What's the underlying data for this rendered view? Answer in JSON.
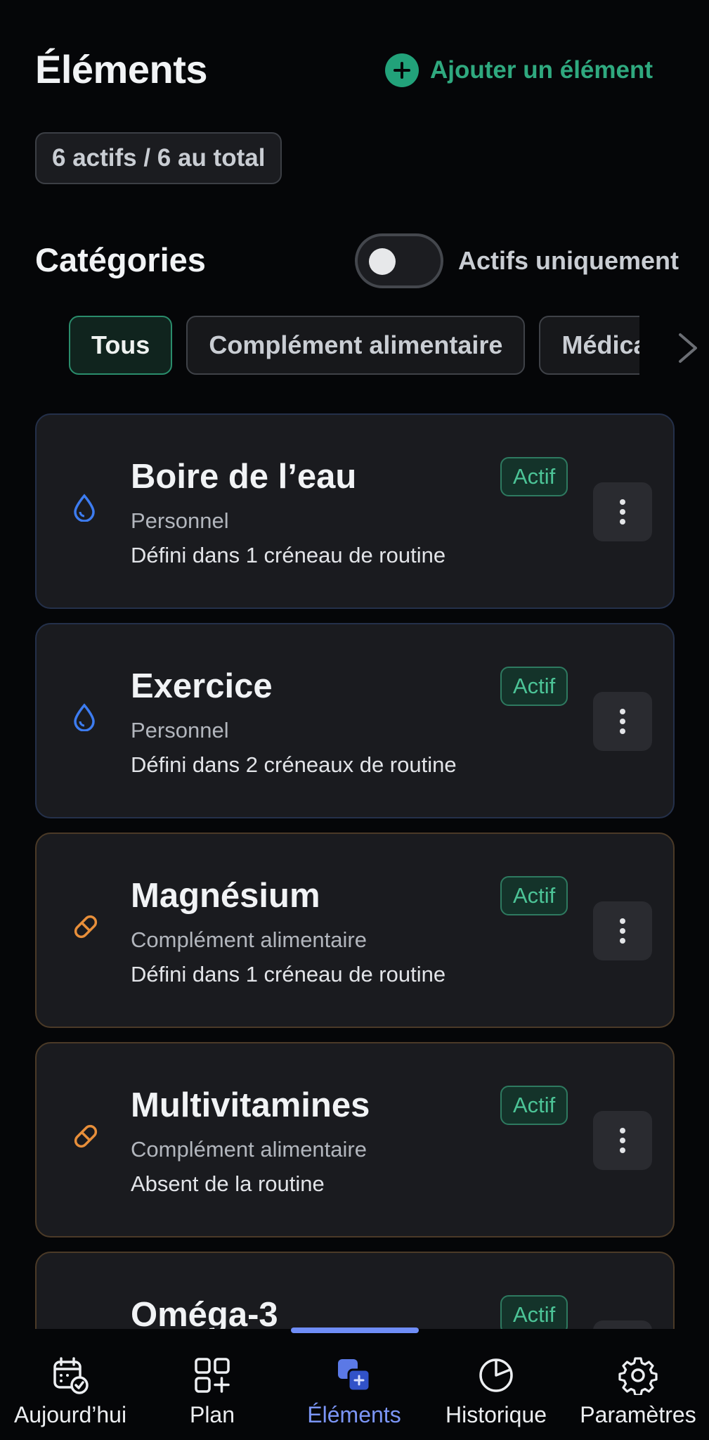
{
  "header": {
    "title": "Éléments",
    "add_label": "Ajouter un élément"
  },
  "summary": {
    "count_label": "6 actifs / 6 au total"
  },
  "categories": {
    "title": "Catégories",
    "toggle_label": "Actifs uniquement",
    "toggle_on": false,
    "chips": [
      {
        "label": "Tous",
        "active": true
      },
      {
        "label": "Complément alimentaire",
        "active": false
      },
      {
        "label": "Médica",
        "active": false
      }
    ]
  },
  "items": [
    {
      "title": "Boire de l’eau",
      "category": "Personnel",
      "routine": "Défini dans 1 créneau de routine",
      "status": "Actif",
      "icon": "water-drop-icon"
    },
    {
      "title": "Exercice",
      "category": "Personnel",
      "routine": "Défini dans 2 créneaux de routine",
      "status": "Actif",
      "icon": "water-drop-icon"
    },
    {
      "title": "Magnésium",
      "category": "Complément alimentaire",
      "routine": "Défini dans 1 créneau de routine",
      "status": "Actif",
      "icon": "pill-icon"
    },
    {
      "title": "Multivitamines",
      "category": "Complément alimentaire",
      "routine": "Absent de la routine",
      "status": "Actif",
      "icon": "pill-icon"
    },
    {
      "title": "Oméga-3",
      "category": "",
      "routine": "",
      "status": "Actif",
      "icon": "pill-icon"
    }
  ],
  "bottom_nav": [
    {
      "label": "Aujourd’hui",
      "icon": "calendar-check-icon",
      "active": false
    },
    {
      "label": "Plan",
      "icon": "grid-plus-icon",
      "active": false
    },
    {
      "label": "Éléments",
      "icon": "items-stack-icon",
      "active": true
    },
    {
      "label": "Historique",
      "icon": "pie-chart-icon",
      "active": false
    },
    {
      "label": "Paramètres",
      "icon": "gear-icon",
      "active": false
    }
  ],
  "colors": {
    "background": "#050608",
    "accent_green": "#22a27a",
    "accent_blue": "#7b95f5",
    "personal_blue": "#3d7cf0",
    "supplement_orange": "#e88f3a"
  }
}
